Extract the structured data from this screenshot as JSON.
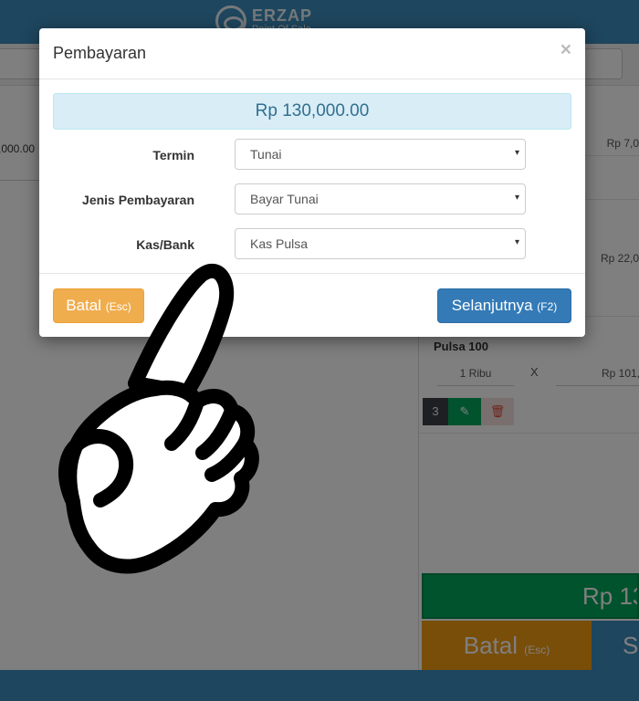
{
  "app": {
    "logo_text": "ERZAP",
    "logo_sub": "Point Of Sale"
  },
  "background": {
    "left_price": ",000.00",
    "right_prices": [
      "Rp 7,0",
      "Rp 22,0"
    ],
    "item": {
      "title": "Pulsa 100",
      "unit": "1 Ribu",
      "times": "X",
      "price": "Rp 101,",
      "qty": "3"
    },
    "total": "Rp 13",
    "cancel_label": "Batal",
    "cancel_key": "(Esc)",
    "next_label": "S"
  },
  "modal": {
    "title": "Pembayaran",
    "close": "×",
    "amount": "Rp 130,000.00",
    "fields": [
      {
        "label": "Termin",
        "value": "Tunai"
      },
      {
        "label": "Jenis Pembayaran",
        "value": "Bayar Tunai"
      },
      {
        "label": "Kas/Bank",
        "value": "Kas Pulsa"
      }
    ],
    "cancel_label": "Batal",
    "cancel_key": "(Esc)",
    "next_label": "Selanjutnya",
    "next_key": "(F2)"
  },
  "icons": {
    "caret": "▾",
    "edit": "✎",
    "delete": "🗑"
  },
  "colors": {
    "primary": "#337ab7",
    "warning": "#f0ad4e",
    "info_bg": "#d9edf7",
    "success": "#00a65a",
    "header": "#3c8dbc"
  }
}
